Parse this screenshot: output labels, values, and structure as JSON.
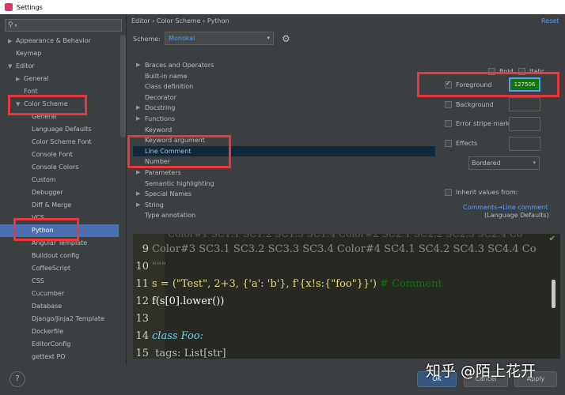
{
  "window": {
    "title": "Settings"
  },
  "search": {
    "icon": "search-icon",
    "placeholder": ""
  },
  "sidebar": {
    "items": [
      {
        "label": "Appearance & Behavior",
        "arrow": "▶",
        "indent": 0
      },
      {
        "label": "Keymap",
        "arrow": "",
        "indent": 0
      },
      {
        "label": "Editor",
        "arrow": "▼",
        "indent": 0
      },
      {
        "label": "General",
        "arrow": "▶",
        "indent": 1
      },
      {
        "label": "Font",
        "arrow": "",
        "indent": 1
      },
      {
        "label": "Color Scheme",
        "arrow": "▼",
        "indent": 1
      },
      {
        "label": "General",
        "arrow": "",
        "indent": 2
      },
      {
        "label": "Language Defaults",
        "arrow": "",
        "indent": 2
      },
      {
        "label": "Color Scheme Font",
        "arrow": "",
        "indent": 2
      },
      {
        "label": "Console Font",
        "arrow": "",
        "indent": 2
      },
      {
        "label": "Console Colors",
        "arrow": "",
        "indent": 2
      },
      {
        "label": "Custom",
        "arrow": "",
        "indent": 2
      },
      {
        "label": "Debugger",
        "arrow": "",
        "indent": 2
      },
      {
        "label": "Diff & Merge",
        "arrow": "",
        "indent": 2
      },
      {
        "label": "VCS",
        "arrow": "",
        "indent": 2
      },
      {
        "label": "Python",
        "arrow": "",
        "indent": 2,
        "selected": true
      },
      {
        "label": "Angular Template",
        "arrow": "",
        "indent": 2
      },
      {
        "label": "Buildout config",
        "arrow": "",
        "indent": 2
      },
      {
        "label": "CoffeeScript",
        "arrow": "",
        "indent": 2
      },
      {
        "label": "CSS",
        "arrow": "",
        "indent": 2
      },
      {
        "label": "Cucumber",
        "arrow": "",
        "indent": 2
      },
      {
        "label": "Database",
        "arrow": "",
        "indent": 2
      },
      {
        "label": "Django/Jinja2 Template",
        "arrow": "",
        "indent": 2
      },
      {
        "label": "Dockerfile",
        "arrow": "",
        "indent": 2
      },
      {
        "label": "EditorConfig",
        "arrow": "",
        "indent": 2
      },
      {
        "label": "gettext PO",
        "arrow": "",
        "indent": 2
      }
    ]
  },
  "breadcrumb": {
    "text": "Editor  ›  Color Scheme  ›  Python"
  },
  "reset": {
    "label": "Reset"
  },
  "scheme": {
    "label": "Scheme:",
    "value": "Monokai"
  },
  "elements": [
    {
      "label": "Braces and Operators",
      "arrow": "▶"
    },
    {
      "label": "Built-in name",
      "arrow": ""
    },
    {
      "label": "Class definition",
      "arrow": ""
    },
    {
      "label": "Decorator",
      "arrow": ""
    },
    {
      "label": "Docstring",
      "arrow": "▶"
    },
    {
      "label": "Functions",
      "arrow": "▶"
    },
    {
      "label": "Keyword",
      "arrow": ""
    },
    {
      "label": "Keyword argument",
      "arrow": ""
    },
    {
      "label": "Line Comment",
      "arrow": "",
      "selected": true
    },
    {
      "label": "Number",
      "arrow": ""
    },
    {
      "label": "Parameters",
      "arrow": "▶"
    },
    {
      "label": "Semantic highlighting",
      "arrow": ""
    },
    {
      "label": "Special Names",
      "arrow": "▶"
    },
    {
      "label": "String",
      "arrow": "▶"
    },
    {
      "label": "Type annotation",
      "arrow": ""
    }
  ],
  "attributes": {
    "bold": "Bold",
    "italic": "Italic",
    "foreground": {
      "label": "Foreground",
      "checked": true,
      "value": "127506",
      "color": "#127506"
    },
    "background": {
      "label": "Background",
      "checked": false
    },
    "error_stripe": {
      "label": "Error stripe mark",
      "checked": false
    },
    "effects": {
      "label": "Effects",
      "checked": false,
      "value": "Bordered"
    },
    "inherit": {
      "label": "Inherit values from:",
      "checked": false
    },
    "inherit_link": "Comments→Line comment",
    "inherit_source": "(Language Defaults)"
  },
  "preview": {
    "lines": [
      {
        "num": "9",
        "html": "Color#3 SC3.1 SC3.2 SC3.3 SC3.4 Color#4 SC4.1 SC4.2 SC4.3 SC4.4 Co"
      },
      {
        "num": "10",
        "html": "\"\"\""
      },
      {
        "num": "11",
        "html": "s = (\"Test\", 2+3, {'a': 'b'}, f'{x!s:{\"foo\"}}')   # Comment"
      },
      {
        "num": "12",
        "html": "f(s[0].lower())"
      },
      {
        "num": "13",
        "html": ""
      },
      {
        "num": "14",
        "html": "class Foo:"
      },
      {
        "num": "15",
        "html": "    tags: List[str]"
      }
    ]
  },
  "buttons": {
    "help": "?",
    "ok": "OK",
    "cancel": "Cancel",
    "apply": "Apply"
  },
  "watermark": "知乎 @陌上花开",
  "colors": {
    "accent": "#589df6",
    "selection": "#4b6eaf",
    "highlight": "#e8383d",
    "comment": "#127506"
  }
}
